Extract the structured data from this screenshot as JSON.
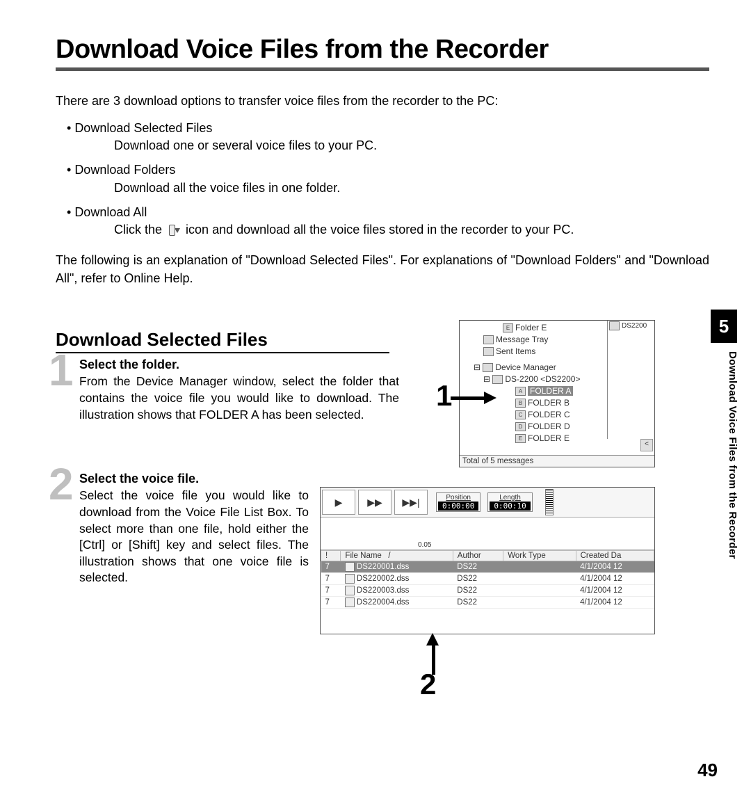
{
  "title": "Download Voice Files from the Recorder",
  "intro": "There are 3 download options to transfer voice files from the recorder to the PC:",
  "options": [
    {
      "title": "Download Selected Files",
      "desc": "Download one or several voice files to your PC."
    },
    {
      "title": "Download Folders",
      "desc": "Download all the voice files in one folder."
    },
    {
      "title": "Download All",
      "desc_pre": "Click the ",
      "desc_post": " icon and download all the voice files stored in the recorder to your PC."
    }
  ],
  "explanation": "The following is an explanation of \"Download Selected Files\". For explanations of \"Download Folders\" and \"Download All\", refer to Online Help.",
  "section_title": "Download Selected Files",
  "steps": [
    {
      "num": "1",
      "title": "Select the folder.",
      "text": "From the Device Manager window, select the folder that contains the voice file you would like to download. The illustration shows that FOLDER A has been selected."
    },
    {
      "num": "2",
      "title": "Select the voice file.",
      "text": "Select the voice file you would like to download from the Voice File List Box. To select more than one file, hold either the [Ctrl] or [Shift] key and select files. The illustration shows that one voice file is selected."
    }
  ],
  "chapter_num": "5",
  "side_label": "Download Voice Files from the Recorder",
  "page_num": "49",
  "shot1": {
    "right_label": "DS2200",
    "tree": {
      "folder_e_top": "Folder E",
      "msg_tray": "Message Tray",
      "sent": "Sent Items",
      "device_mgr": "Device Manager",
      "device": "DS-2200 <DS2200>",
      "fa": "FOLDER A",
      "fb": "FOLDER B",
      "fc": "FOLDER C",
      "fd": "FOLDER D",
      "fe": "FOLDER E"
    },
    "status": "Total of 5 messages",
    "scroll_sym": "<"
  },
  "shot2": {
    "play_sym": "▶",
    "ff_sym": "▶▶",
    "next_sym": "▶▶|",
    "pos_label": "Position",
    "pos_val": "0:00:00",
    "len_label": "Length",
    "len_val": "0:00:10",
    "tick": "0.05",
    "headers": {
      "pri": "!",
      "name": "File Name",
      "sort": "/",
      "author": "Author",
      "work": "Work Type",
      "created": "Created Da"
    },
    "rows": [
      {
        "pri": "7",
        "name": "DS220001.dss",
        "author": "DS22",
        "work": "",
        "created": "4/1/2004 12"
      },
      {
        "pri": "7",
        "name": "DS220002.dss",
        "author": "DS22",
        "work": "",
        "created": "4/1/2004 12"
      },
      {
        "pri": "7",
        "name": "DS220003.dss",
        "author": "DS22",
        "work": "",
        "created": "4/1/2004 12"
      },
      {
        "pri": "7",
        "name": "DS220004.dss",
        "author": "DS22",
        "work": "",
        "created": "4/1/2004 12"
      }
    ]
  },
  "callouts": {
    "c1": "1",
    "c2": "2"
  }
}
